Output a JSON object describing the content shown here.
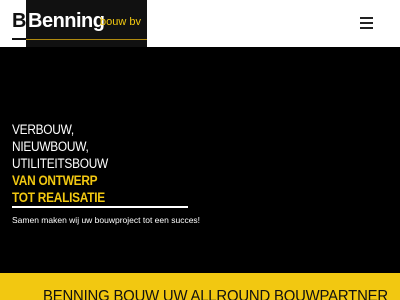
{
  "header": {
    "logo_ghost": "B",
    "logo_name": "Benning",
    "logo_sub": "bouw bv",
    "menu_icon": "hamburger-menu-icon"
  },
  "hero": {
    "lines": [
      "VERBOUW,",
      "NIEUWBOUW,",
      "UTILITEITSBOUW"
    ],
    "accent_lines": [
      "VAN ONTWERP",
      "TOT REALISATIE"
    ],
    "tagline": "Samen maken wij uw bouwproject tot een succes!"
  },
  "band": {
    "title": "BENNING BOUW UW ALLROUND BOUWPARTNER"
  },
  "colors": {
    "accent": "#f2c811",
    "dark": "#000000",
    "light": "#ffffff"
  }
}
